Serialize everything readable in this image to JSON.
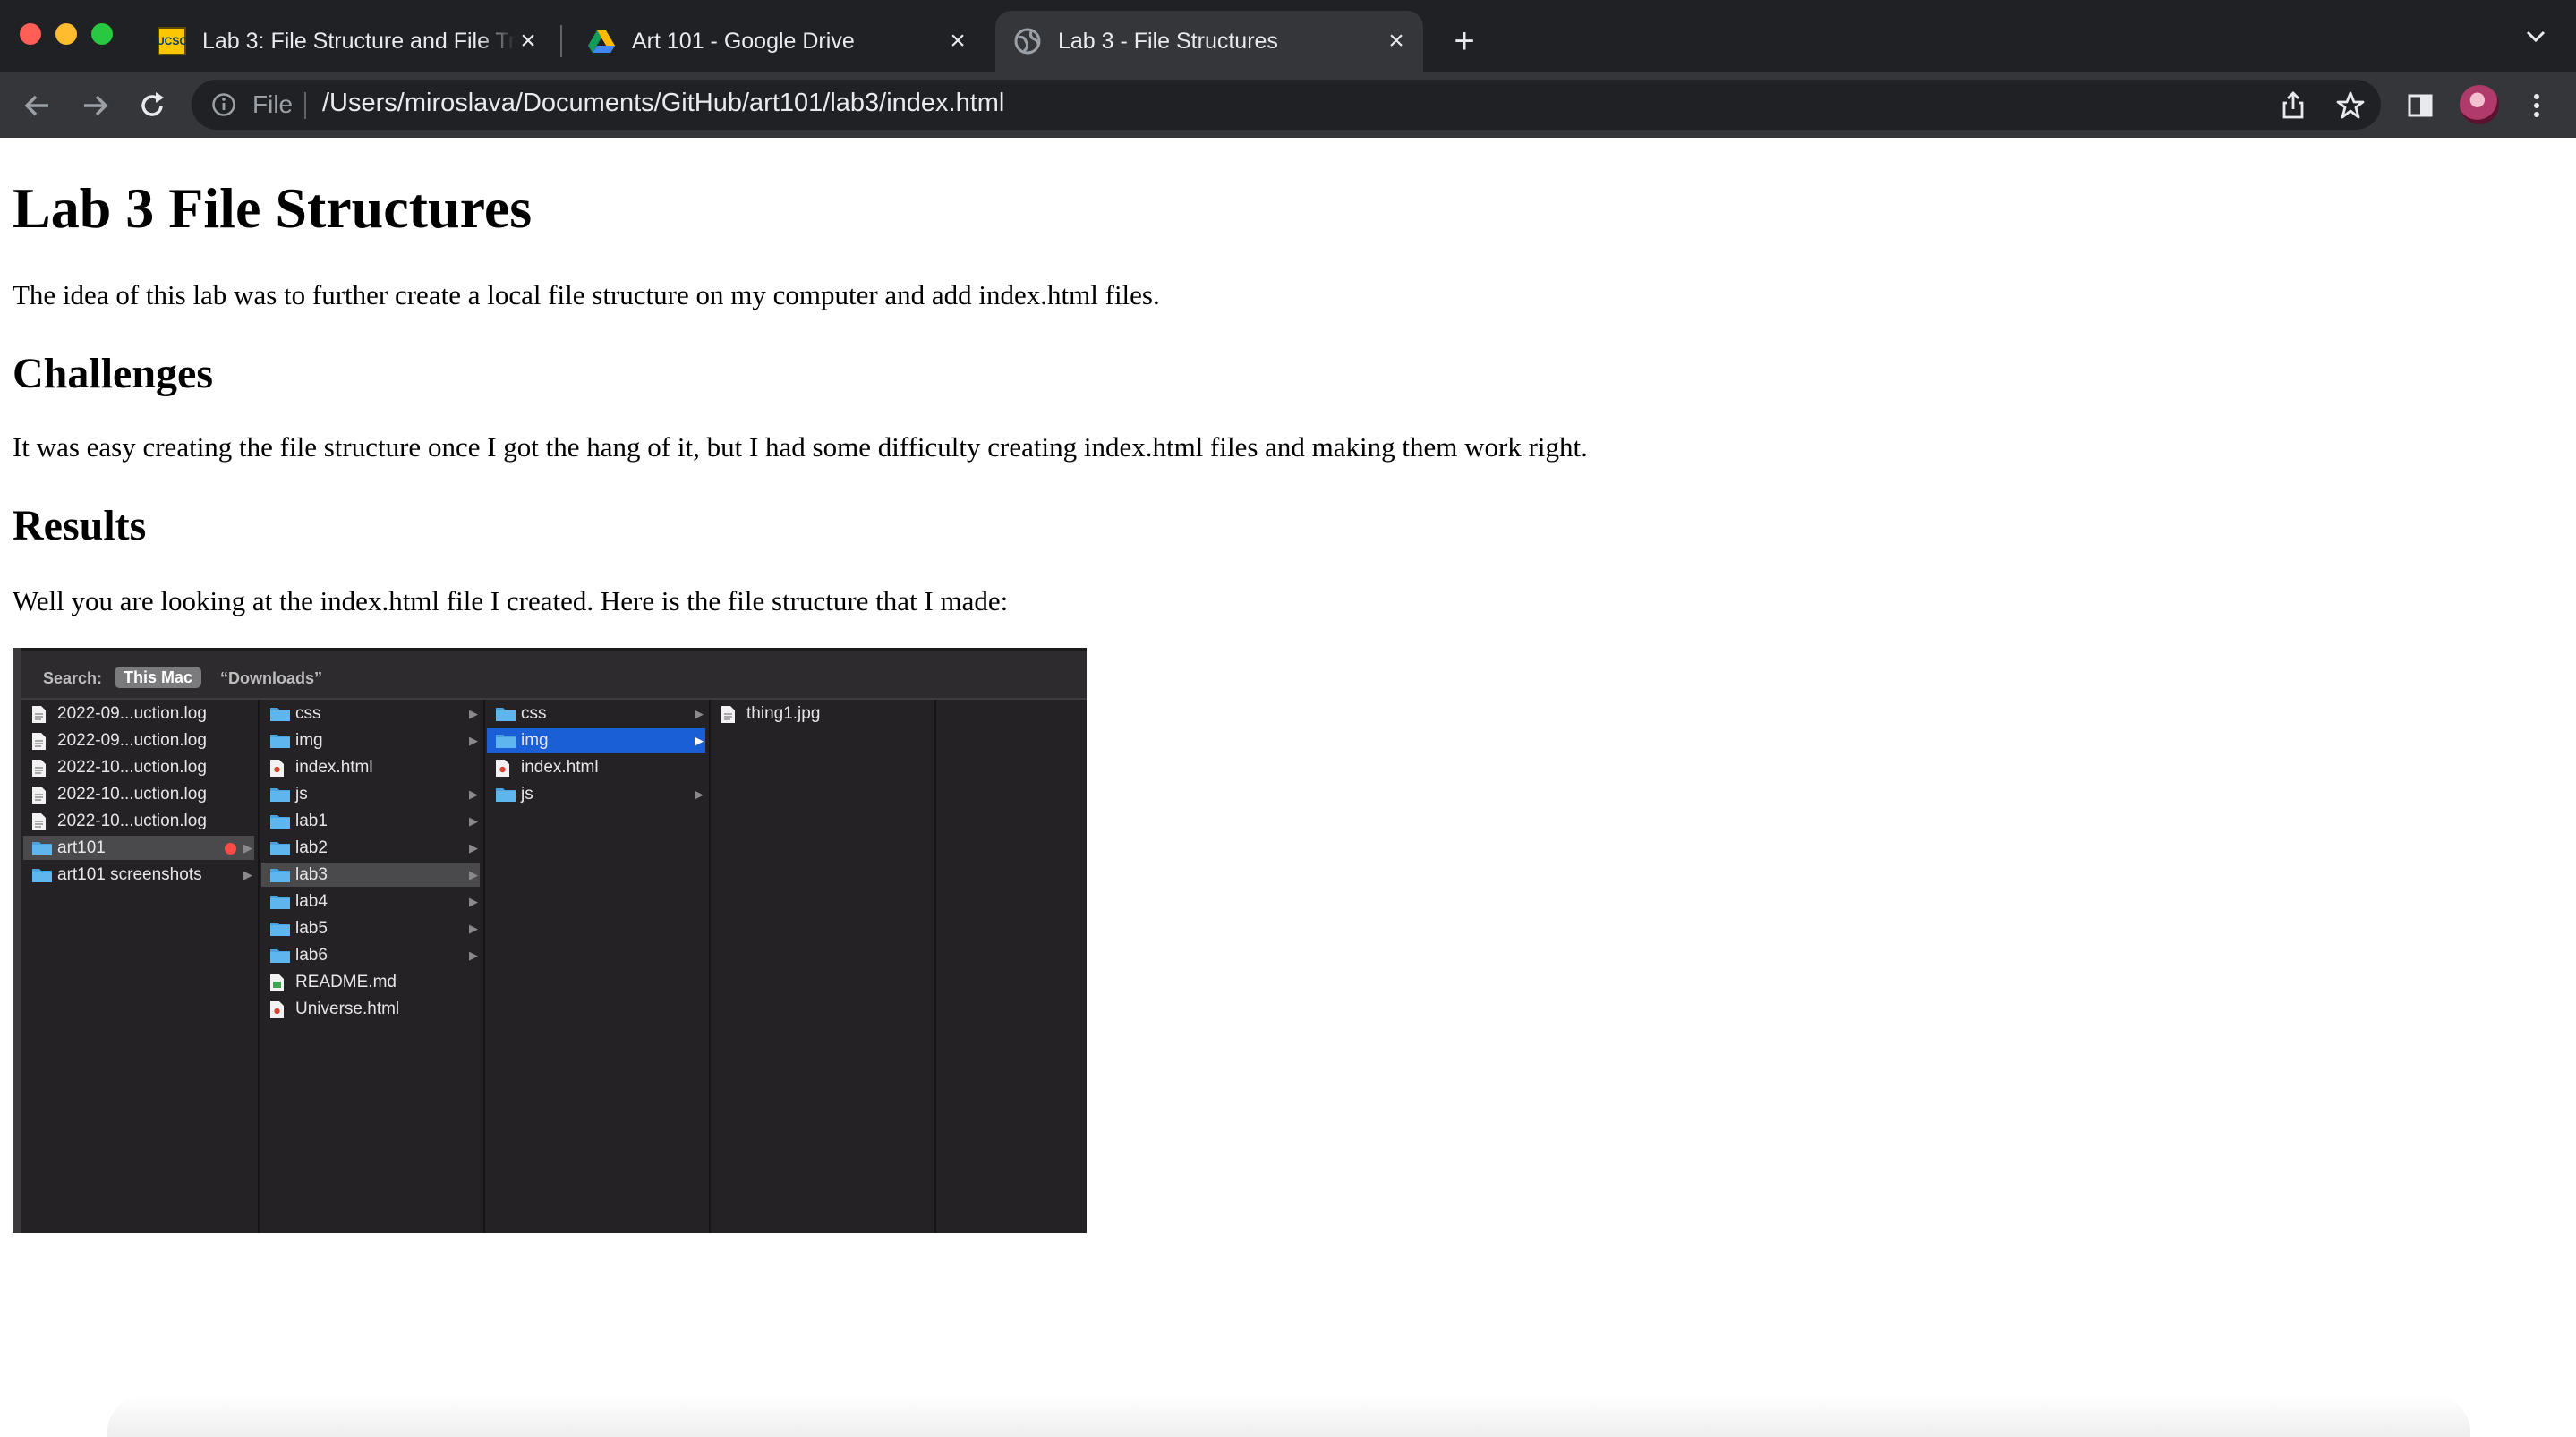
{
  "browser": {
    "tabs": [
      {
        "title": "Lab 3: File Structure and File Tr",
        "favicon": "ucsc-logo-icon",
        "favicon_text": "UCSC"
      },
      {
        "title": "Art 101 - Google Drive",
        "favicon": "google-drive-icon"
      },
      {
        "title": "Lab 3 - File Structures",
        "favicon": "globe-icon",
        "active": true
      }
    ],
    "new_tab_label": "+",
    "close_glyph": "×",
    "address": {
      "scheme": "File",
      "url": "/Users/miroslava/Documents/GitHub/art101/lab3/index.html"
    },
    "colors": {
      "tabbar": "#202124",
      "toolbar": "#35363a",
      "omnibox": "#202124"
    }
  },
  "page": {
    "title": "Lab 3 File Structures",
    "intro": "The idea of this lab was to further create a local file structure on my computer and add index.html files.",
    "challenges_heading": "Challenges",
    "challenges_text": "It was easy creating the file structure once I got the hang of it, but I had some difficulty creating index.html files and making them work right.",
    "results_heading": "Results",
    "results_text": "Well you are looking at the index.html file I created. Here is the file structure that I made:"
  },
  "finder": {
    "search_label": "Search:",
    "scope_active": "This Mac",
    "scope_other": "“Downloads”",
    "columns": [
      [
        {
          "name": "2022-09...uction.log",
          "type": "doc"
        },
        {
          "name": "2022-09...uction.log",
          "type": "doc"
        },
        {
          "name": "2022-10...uction.log",
          "type": "doc"
        },
        {
          "name": "2022-10...uction.log",
          "type": "doc"
        },
        {
          "name": "2022-10...uction.log",
          "type": "doc"
        },
        {
          "name": "art101",
          "type": "folder",
          "selected": "grey",
          "tag": "red"
        },
        {
          "name": "art101 screenshots",
          "type": "folder"
        }
      ],
      [
        {
          "name": "css",
          "type": "folder"
        },
        {
          "name": "img",
          "type": "folder"
        },
        {
          "name": "index.html",
          "type": "html"
        },
        {
          "name": "js",
          "type": "folder"
        },
        {
          "name": "lab1",
          "type": "folder"
        },
        {
          "name": "lab2",
          "type": "folder"
        },
        {
          "name": "lab3",
          "type": "folder",
          "selected": "grey"
        },
        {
          "name": "lab4",
          "type": "folder"
        },
        {
          "name": "lab5",
          "type": "folder"
        },
        {
          "name": "lab6",
          "type": "folder"
        },
        {
          "name": "README.md",
          "type": "md"
        },
        {
          "name": "Universe.html",
          "type": "html"
        }
      ],
      [
        {
          "name": "css",
          "type": "folder"
        },
        {
          "name": "img",
          "type": "folder",
          "selected": "blue"
        },
        {
          "name": "index.html",
          "type": "html"
        },
        {
          "name": "js",
          "type": "folder"
        }
      ],
      [
        {
          "name": "thing1.jpg",
          "type": "doc"
        }
      ],
      []
    ]
  }
}
